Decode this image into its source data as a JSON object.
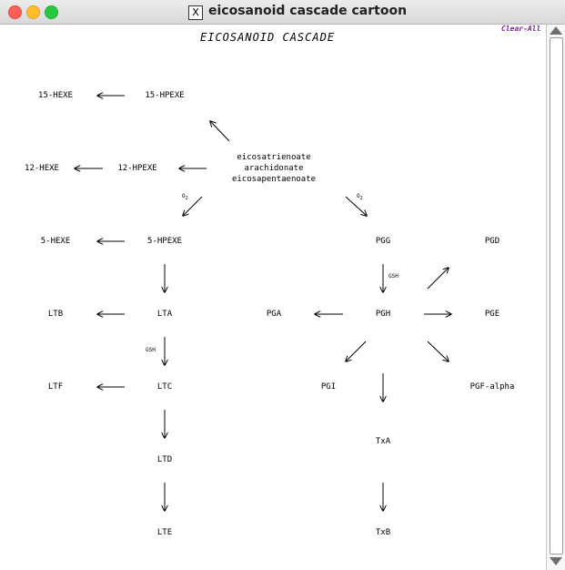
{
  "window": {
    "title": "eicosanoid cascade cartoon"
  },
  "heading": "EICOSANOID CASCADE",
  "clear_all": "Clear-All",
  "nodes": {
    "hexe15": "15-HEXE",
    "hpexe15": "15-HPEXE",
    "hexe12": "12-HEXE",
    "hpexe12": "12-HPEXE",
    "hexe5": "5-HEXE",
    "hpexe5": "5-HPEXE",
    "substrate1": "eicosatrienoate",
    "substrate2": "arachidonate",
    "substrate3": "eicosapentaenoate",
    "pgg": "PGG",
    "pgd": "PGD",
    "ltb": "LTB",
    "lta": "LTA",
    "pga": "PGA",
    "pgh": "PGH",
    "pge": "PGE",
    "ltf": "LTF",
    "ltc": "LTC",
    "pgi": "PGI",
    "pgf": "PGF-alpha",
    "txa": "TxA",
    "ltd": "LTD",
    "lte": "LTE",
    "txb": "TxB"
  },
  "notes": {
    "o2_left": "O",
    "o2_right": "O",
    "sub_2": "2",
    "gsh_pgh": "GSH",
    "gsh_ltc": "GSH"
  }
}
